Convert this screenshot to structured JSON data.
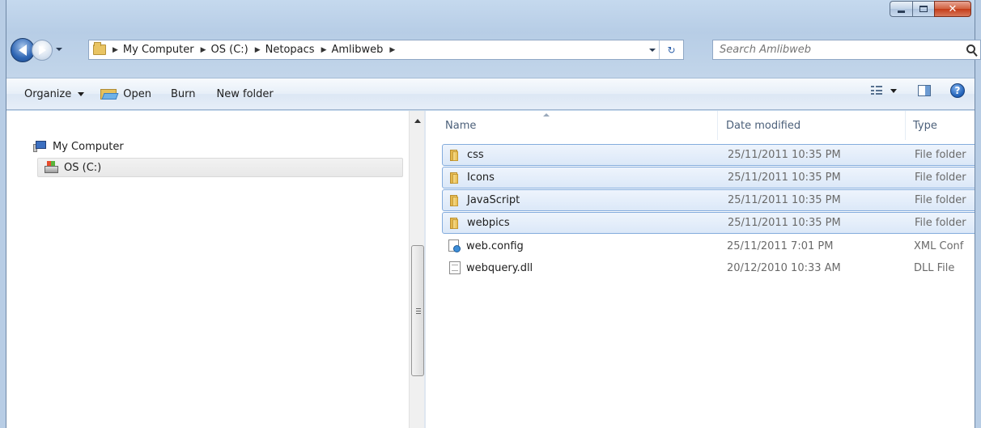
{
  "window": {
    "caption_buttons": {
      "minimize": "minimize-icon",
      "maximize": "maximize-icon",
      "close": "✕"
    }
  },
  "address_bar": {
    "breadcrumbs": [
      "My Computer",
      "OS (C:)",
      "Netopacs",
      "Amlibweb"
    ]
  },
  "search": {
    "placeholder": "Search Amlibweb"
  },
  "toolbar": {
    "organize": "Organize",
    "open": "Open",
    "burn": "Burn",
    "new_folder": "New folder",
    "help": "?"
  },
  "nav_pane": {
    "items": [
      {
        "label": "My Computer",
        "icon": "computer-icon"
      },
      {
        "label": "OS (C:)",
        "icon": "drive-icon",
        "selected": true
      }
    ]
  },
  "columns": {
    "name": "Name",
    "date": "Date modified",
    "type": "Type"
  },
  "files": [
    {
      "name": "css",
      "date": "25/11/2011 10:35 PM",
      "type": "File folder",
      "icon": "folder-icon",
      "selected": true
    },
    {
      "name": "Icons",
      "date": "25/11/2011 10:35 PM",
      "type": "File folder",
      "icon": "folder-icon",
      "selected": true
    },
    {
      "name": "JavaScript",
      "date": "25/11/2011 10:35 PM",
      "type": "File folder",
      "icon": "folder-icon",
      "selected": true
    },
    {
      "name": "webpics",
      "date": "25/11/2011 10:35 PM",
      "type": "File folder",
      "icon": "folder-icon",
      "selected": true
    },
    {
      "name": "web.config",
      "date": "25/11/2011 7:01 PM",
      "type": "XML Conf",
      "icon": "config-file-icon",
      "selected": false
    },
    {
      "name": "webquery.dll",
      "date": "20/12/2010 10:33 AM",
      "type": "DLL File",
      "icon": "dll-file-icon",
      "selected": false
    }
  ],
  "colors": {
    "selection_fill": "#dbe8f8",
    "selection_border": "#84acdd",
    "frame": "#b8cde5"
  }
}
